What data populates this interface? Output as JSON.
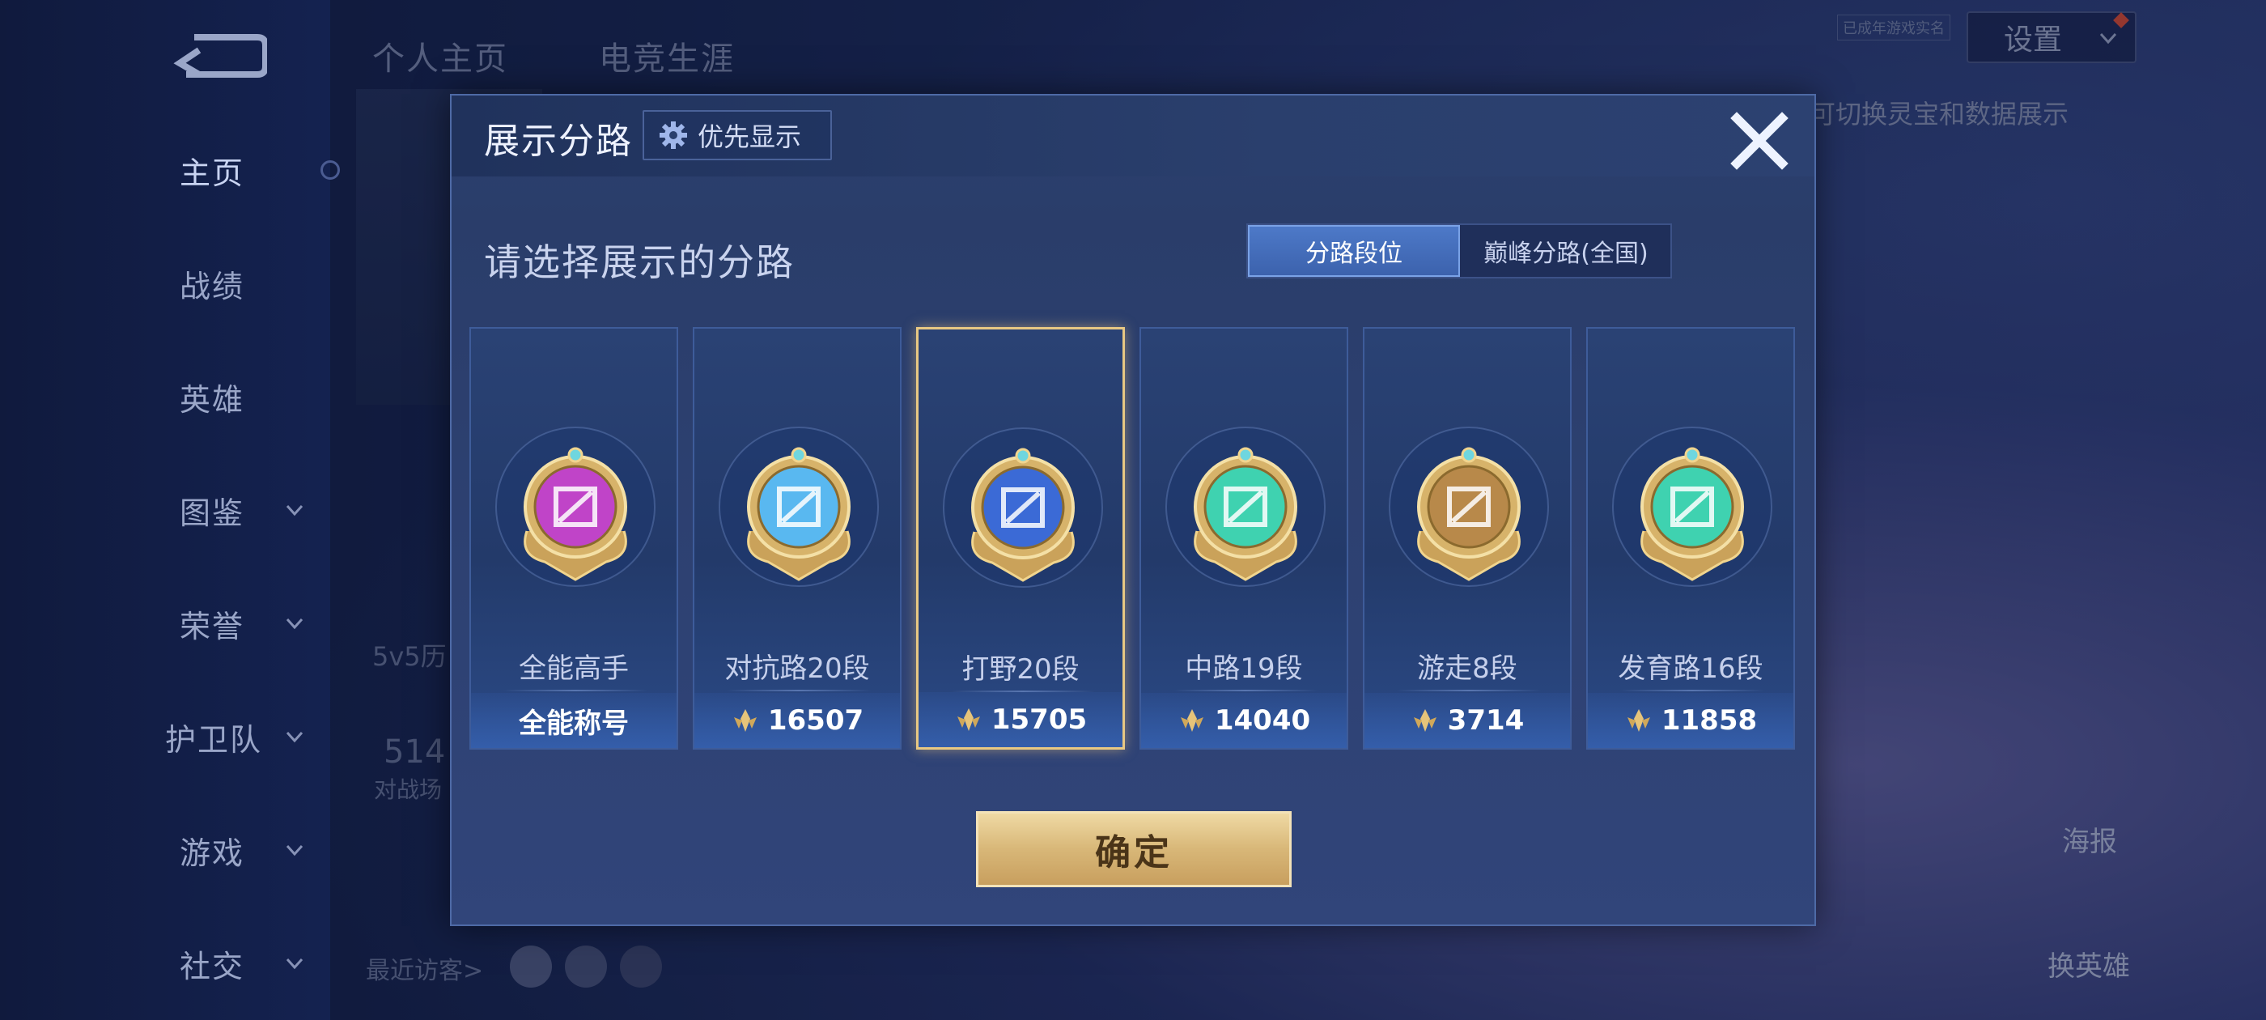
{
  "background": {
    "profile_tabs": [
      "个人主页",
      "电竞生涯"
    ],
    "settings_label": "设置",
    "verify_badge": "已成年游戏实名",
    "hint": "可切换灵宝和数据展示",
    "faded_left": [
      "5v5历",
      "514",
      "对战场"
    ],
    "recent_visitors": "最近访客>",
    "right_buttons": [
      "海报",
      "换英雄"
    ]
  },
  "sidebar": {
    "items": [
      {
        "label": "主页",
        "active": true,
        "has_chevron": false
      },
      {
        "label": "战绩",
        "active": false,
        "has_chevron": false
      },
      {
        "label": "英雄",
        "active": false,
        "has_chevron": false
      },
      {
        "label": "图鉴",
        "active": false,
        "has_chevron": true
      },
      {
        "label": "荣誉",
        "active": false,
        "has_chevron": true
      },
      {
        "label": "护卫队",
        "active": false,
        "has_chevron": true
      },
      {
        "label": "游戏",
        "active": false,
        "has_chevron": true
      },
      {
        "label": "社交",
        "active": false,
        "has_chevron": true
      }
    ]
  },
  "modal": {
    "title": "展示分路",
    "priority_label": "优先显示",
    "select_title": "请选择展示的分路",
    "segment": {
      "options": [
        "分路段位",
        "巅峰分路(全国)"
      ],
      "selected": 0
    },
    "cards": [
      {
        "rank": "全能高手",
        "value": "全能称号",
        "has_points": false,
        "selected": false,
        "emblem": "all-round-emblem-icon",
        "color": "#c044c8"
      },
      {
        "rank": "对抗路20段",
        "value": "16507",
        "has_points": true,
        "selected": false,
        "emblem": "clash-lane-emblem-icon",
        "color": "#59b8f0"
      },
      {
        "rank": "打野20段",
        "value": "15705",
        "has_points": true,
        "selected": true,
        "emblem": "jungle-emblem-icon",
        "color": "#3b6ad6"
      },
      {
        "rank": "中路19段",
        "value": "14040",
        "has_points": true,
        "selected": false,
        "emblem": "mid-lane-emblem-icon",
        "color": "#3fd2b0"
      },
      {
        "rank": "游走8段",
        "value": "3714",
        "has_points": true,
        "selected": false,
        "emblem": "roam-emblem-icon",
        "color": "#b8894a"
      },
      {
        "rank": "发育路16段",
        "value": "11858",
        "has_points": true,
        "selected": false,
        "emblem": "farm-lane-emblem-icon",
        "color": "#3fd2b0"
      }
    ],
    "confirm_label": "确定"
  }
}
